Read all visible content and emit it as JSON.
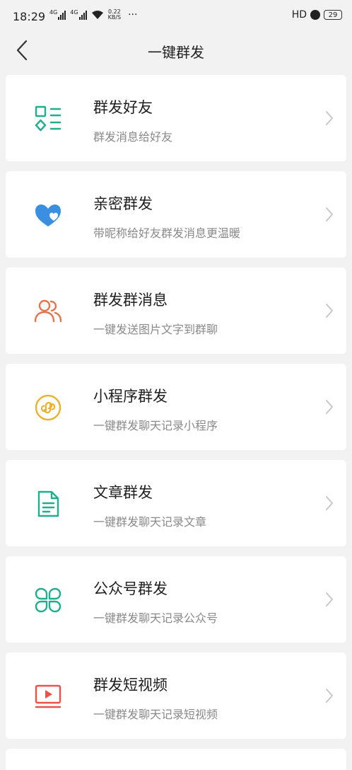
{
  "status_bar": {
    "time": "18:29",
    "net1": "4G",
    "net2": "4G",
    "speed_value": "0.22",
    "speed_unit": "KB/S",
    "more": "···",
    "hd": "HD",
    "battery": "29"
  },
  "header": {
    "title": "一键群发"
  },
  "items": [
    {
      "title": "群发好友",
      "subtitle": "群发消息给好友",
      "icon": "grid-shapes-icon",
      "color": "#1fae8e"
    },
    {
      "title": "亲密群发",
      "subtitle": "带昵称给好友群发消息更温暖",
      "icon": "hearts-icon",
      "color": "#3a8fe0"
    },
    {
      "title": "群发群消息",
      "subtitle": "一键发送图片文字到群聊",
      "icon": "users-icon",
      "color": "#e8734a"
    },
    {
      "title": "小程序群发",
      "subtitle": "一键群发聊天记录小程序",
      "icon": "mini-program-icon",
      "color": "#e9b22d"
    },
    {
      "title": "文章群发",
      "subtitle": "一键群发聊天记录文章",
      "icon": "document-icon",
      "color": "#1fae8e"
    },
    {
      "title": "公众号群发",
      "subtitle": "一键群发聊天记录公众号",
      "icon": "clover-icon",
      "color": "#1fae8e"
    },
    {
      "title": "群发短视频",
      "subtitle": "一键群发聊天记录短视频",
      "icon": "video-icon",
      "color": "#e8524a"
    }
  ]
}
